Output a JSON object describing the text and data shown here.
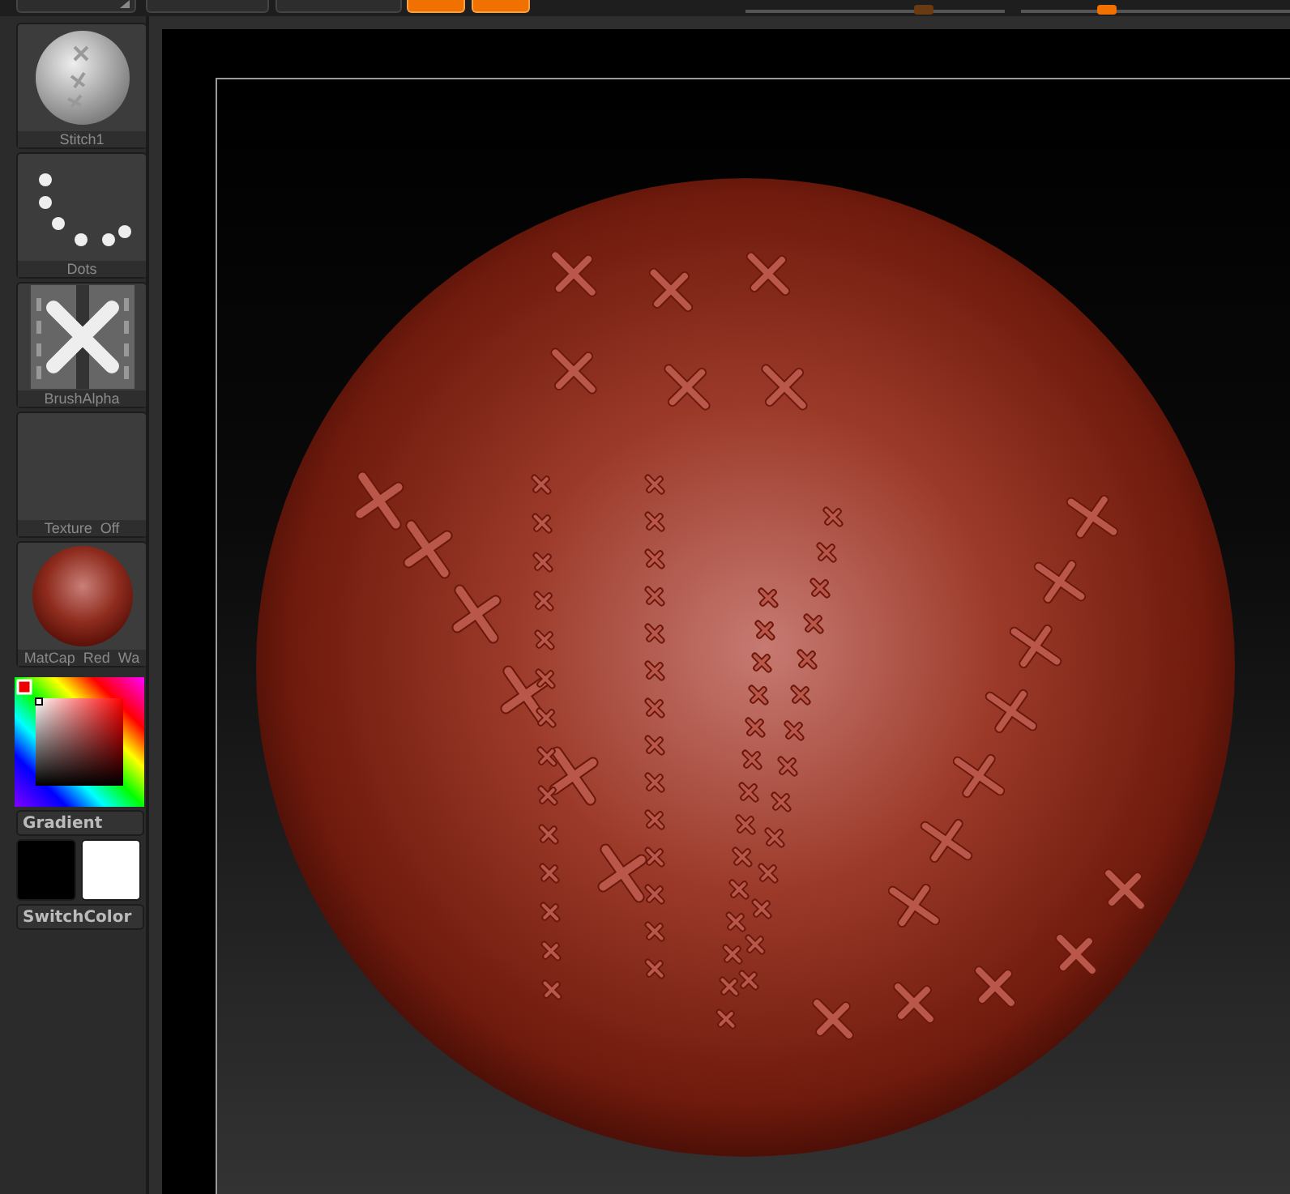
{
  "toolbar": {
    "buttons": [
      {
        "kind": "dropdown",
        "selected": false
      },
      {
        "kind": "plain",
        "selected": false
      },
      {
        "kind": "plain",
        "selected": false
      },
      {
        "kind": "mode",
        "selected": true
      },
      {
        "kind": "mode",
        "selected": true
      }
    ],
    "sliders": [
      {
        "level": 0.69
      },
      {
        "level": 0.32
      }
    ]
  },
  "tray": {
    "tiles": [
      {
        "kind": "brush",
        "label": "Stitch1"
      },
      {
        "kind": "stroke",
        "label": "Dots"
      },
      {
        "kind": "alpha",
        "label": "BrushAlpha"
      },
      {
        "kind": "texture",
        "label": "Texture  Off"
      },
      {
        "kind": "material",
        "label": "MatCap  Red  Wa"
      }
    ],
    "gradient_button": "Gradient",
    "swatches": [
      {
        "color": "#000000"
      },
      {
        "color": "#ffffff"
      }
    ],
    "switch_button": "SwitchColor"
  }
}
